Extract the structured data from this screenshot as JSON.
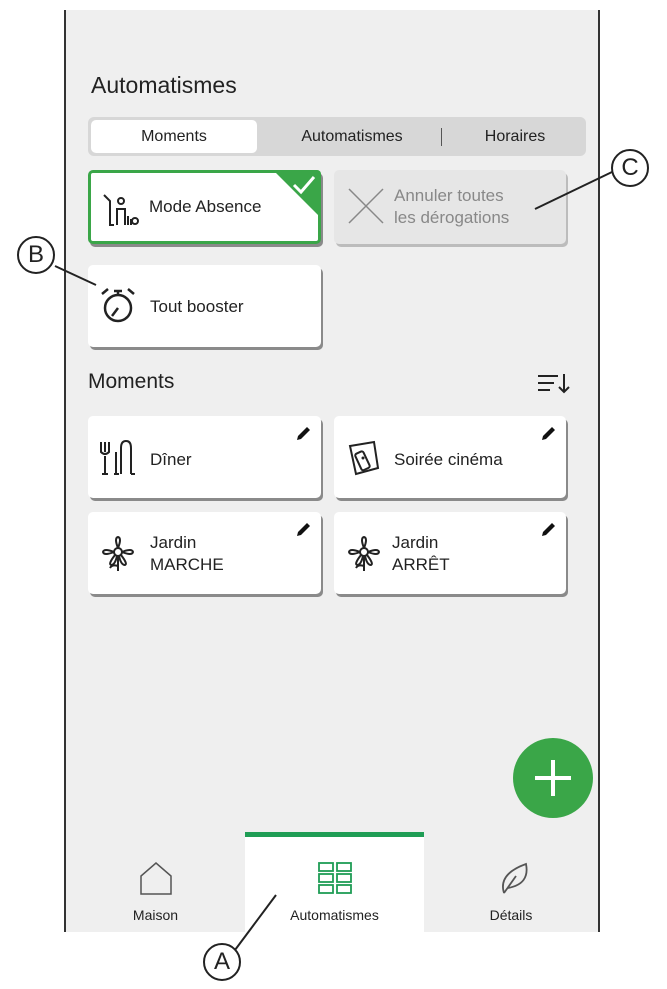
{
  "header": {
    "title": "Automatismes"
  },
  "segmented": {
    "tabs": [
      "Moments",
      "Automatismes",
      "Horaires"
    ],
    "active": "Moments"
  },
  "quick": {
    "absence": {
      "label": "Mode Absence",
      "active": true
    },
    "cancel": {
      "line1": "Annuler toutes",
      "line2": "les dérogations",
      "disabled": true
    },
    "boost": {
      "label": "Tout booster"
    }
  },
  "moments": {
    "title": "Moments",
    "items": [
      {
        "label": "Dîner",
        "icon": "cutlery-icon"
      },
      {
        "label": "Soirée cinéma",
        "icon": "remote-control-icon"
      },
      {
        "line1": "Jardin",
        "line2": "MARCHE",
        "icon": "flower-icon"
      },
      {
        "line1": "Jardin",
        "line2": "ARRÊT",
        "icon": "flower-icon"
      }
    ]
  },
  "nav": {
    "tabs": [
      {
        "label": "Maison",
        "icon": "house-icon"
      },
      {
        "label": "Automatismes",
        "icon": "grid-icon",
        "active": true
      },
      {
        "label": "Détails",
        "icon": "leaf-icon"
      }
    ]
  },
  "callouts": {
    "a": "A",
    "b": "B",
    "c": "C"
  },
  "colors": {
    "accent": "#3aa648",
    "background": "#efefef",
    "nav_indicator": "#1f9d55"
  }
}
